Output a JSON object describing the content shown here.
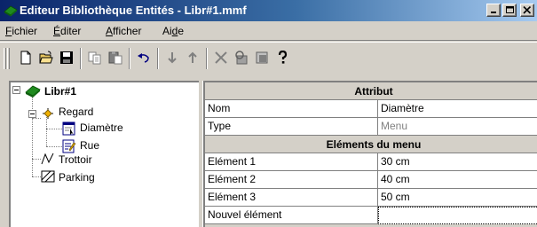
{
  "window": {
    "title": "Editeur Bibliothèque Entités - Libr#1.mmf",
    "controls": [
      "minimize",
      "maximize",
      "close"
    ]
  },
  "menu": [
    {
      "pre": "",
      "u": "F",
      "post": "ichier"
    },
    {
      "pre": "",
      "u": "É",
      "post": "diter"
    },
    {
      "pre": "",
      "u": "A",
      "post": "fficher"
    },
    {
      "pre": "Ai",
      "u": "d",
      "post": "e"
    }
  ],
  "toolbar": {
    "icons": [
      "new-file-icon",
      "open-folder-icon",
      "save-icon",
      "copy-icon",
      "paste-icon",
      "undo-icon",
      "move-down-icon",
      "move-up-icon",
      "delete-icon",
      "properties-icon",
      "export-icon",
      "help-icon"
    ]
  },
  "tree": {
    "root": {
      "label": "Libr#1",
      "icon": "library-icon"
    },
    "items": [
      {
        "label": "Regard",
        "icon": "regard-icon"
      },
      {
        "label": "Diamètre",
        "icon": "attribute-list-icon"
      },
      {
        "label": "Rue",
        "icon": "attribute-text-icon"
      },
      {
        "label": "Trottoir",
        "icon": "polyline-icon"
      },
      {
        "label": "Parking",
        "icon": "hatched-area-icon"
      }
    ]
  },
  "grid": {
    "header": "Attribut",
    "rows": [
      {
        "name": "Nom",
        "value": "Diamètre"
      },
      {
        "name": "Type",
        "value": "Menu"
      }
    ],
    "section": "Eléments du menu",
    "menu_rows": [
      {
        "name": "Elément 1",
        "value": "30 cm"
      },
      {
        "name": "Elément 2",
        "value": "40 cm"
      },
      {
        "name": "Elément 3",
        "value": "50 cm"
      },
      {
        "name": "Nouvel élément",
        "value": ""
      }
    ]
  },
  "colors": {
    "titlebar_start": "#0a246a",
    "titlebar_end": "#a6caf0",
    "face": "#d4d0c8"
  }
}
